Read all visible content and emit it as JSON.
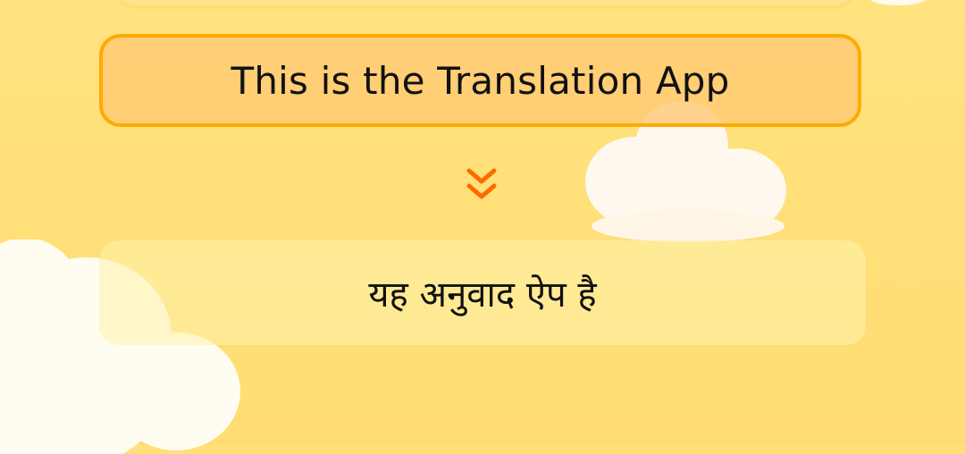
{
  "translation": {
    "source_text": "This is the Translation App",
    "translated_text": "यह अनुवाद ऐप है"
  },
  "icons": {
    "direction": "double-chevron-down-icon"
  },
  "colors": {
    "background": "#ffe07a",
    "source_border": "#ffaa00",
    "source_fill": "#ffc873",
    "arrow": "#ff6a00",
    "result_fill": "#fff1aa"
  }
}
